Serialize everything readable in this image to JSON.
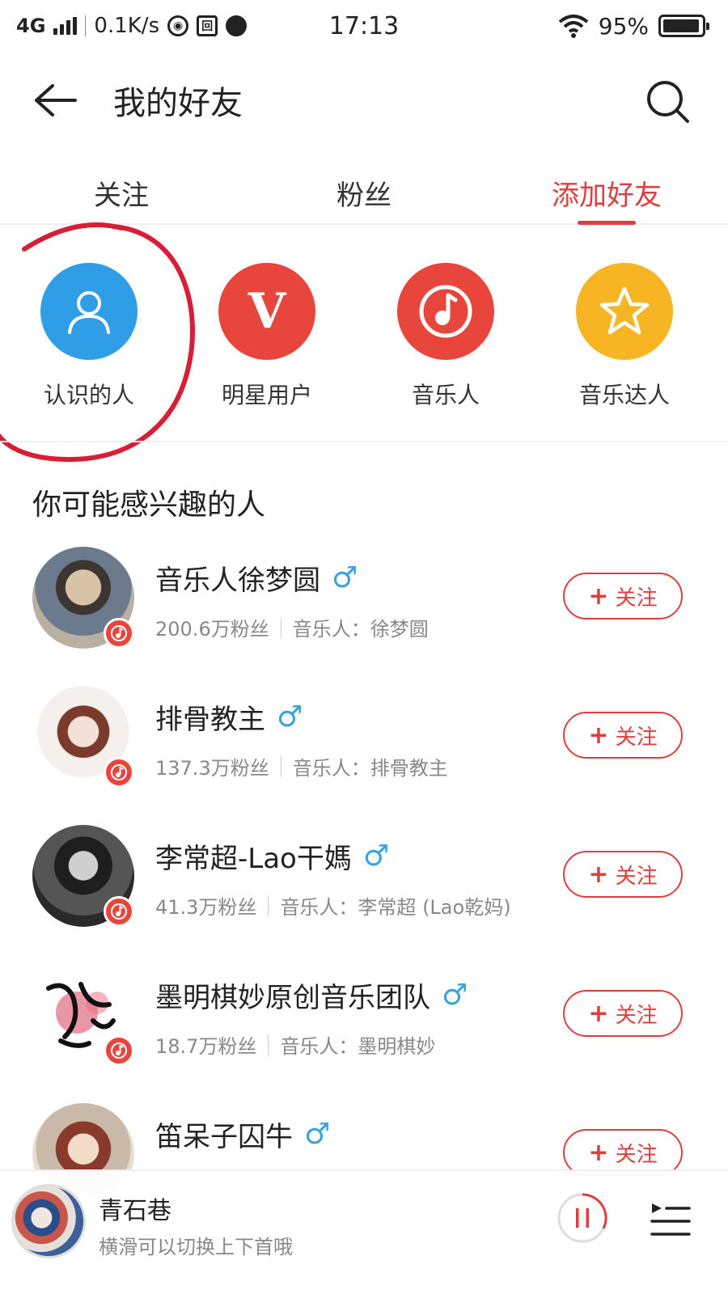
{
  "status_bar": {
    "network": "4G",
    "speed": "0.1K/s",
    "time": "17:13",
    "battery": "95%",
    "battery_level": 0.95
  },
  "header": {
    "title": "我的好友",
    "back_icon": "arrow-left-icon",
    "search_icon": "search-icon"
  },
  "tabs": [
    {
      "label": "关注",
      "active": false
    },
    {
      "label": "粉丝",
      "active": false
    },
    {
      "label": "添加好友",
      "active": true
    }
  ],
  "categories": [
    {
      "label": "认识的人",
      "icon": "person-icon",
      "color": "#2f9ee6"
    },
    {
      "label": "明星用户",
      "icon": "v-icon",
      "color": "#e8463c"
    },
    {
      "label": "音乐人",
      "icon": "music-note-icon",
      "color": "#e8463c"
    },
    {
      "label": "音乐达人",
      "icon": "star-icon",
      "color": "#f7b524"
    }
  ],
  "section_title": "你可能感兴趣的人",
  "users": [
    {
      "name": "音乐人徐梦圆",
      "gender": "♂",
      "fans": "200.6万粉丝",
      "desc": "音乐人：徐梦圆",
      "follow": "关注"
    },
    {
      "name": "排骨教主",
      "gender": "♂",
      "fans": "137.3万粉丝",
      "desc": "音乐人：排骨教主",
      "follow": "关注"
    },
    {
      "name": "李常超-Lao干媽",
      "gender": "♂",
      "fans": "41.3万粉丝",
      "desc": "音乐人：李常超 (Lao乾妈)",
      "follow": "关注"
    },
    {
      "name": "墨明棋妙原创音乐团队",
      "gender": "♂",
      "fans": "18.7万粉丝",
      "desc": "音乐人：墨明棋妙",
      "follow": "关注"
    },
    {
      "name": "笛呆子囚牛",
      "gender": "♂",
      "fans": "",
      "desc": "",
      "follow": "关注"
    }
  ],
  "player": {
    "title": "青石巷",
    "subtitle": "横滑可以切换上下首哦"
  },
  "colors": {
    "accent": "#e03e3e",
    "gender": "#3aa3e0"
  }
}
